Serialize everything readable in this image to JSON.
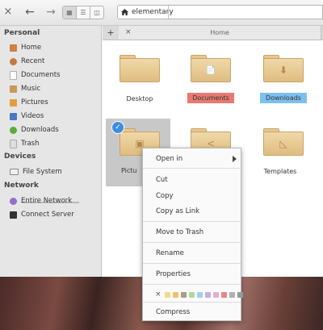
{
  "toolbar": {
    "close_icon": "×",
    "back_icon": "←",
    "forward_icon": "→",
    "view_modes": [
      "grid",
      "list",
      "columns"
    ],
    "path": "elementary"
  },
  "sidebar": {
    "sections": [
      {
        "title": "Personal",
        "items": [
          {
            "label": "Home",
            "icon": "home-icon",
            "color": "#d08040"
          },
          {
            "label": "Recent",
            "icon": "recent-icon",
            "color": "#c07a40"
          },
          {
            "label": "Documents",
            "icon": "documents-icon",
            "color": "#b0b0b0"
          },
          {
            "label": "Music",
            "icon": "music-icon",
            "color": "#c89858"
          },
          {
            "label": "Pictures",
            "icon": "pictures-icon",
            "color": "#e0a040"
          },
          {
            "label": "Videos",
            "icon": "videos-icon",
            "color": "#4a78c0"
          },
          {
            "label": "Downloads",
            "icon": "downloads-icon",
            "color": "#5caa3a"
          },
          {
            "label": "Trash",
            "icon": "trash-icon",
            "color": "#aaaaaa"
          }
        ]
      },
      {
        "title": "Devices",
        "items": [
          {
            "label": "File System",
            "icon": "drive-icon",
            "color": "#888888"
          }
        ]
      },
      {
        "title": "Network",
        "items": [
          {
            "label": "Entire Network",
            "icon": "network-icon",
            "color": "#9a6cc8"
          },
          {
            "label": "Connect Server",
            "icon": "server-icon",
            "color": "#333333"
          }
        ]
      }
    ]
  },
  "tabs": {
    "add_label": "+",
    "close_label": "×",
    "items": [
      {
        "label": "Home"
      }
    ]
  },
  "files": [
    {
      "name": "Desktop",
      "glyph": "",
      "tag_color": ""
    },
    {
      "name": "Documents",
      "glyph": "📄",
      "tag_color": "#e87a72"
    },
    {
      "name": "Downloads",
      "glyph": "⬇",
      "tag_color": "#7cc0f0"
    },
    {
      "name": "Pictu",
      "glyph": "▣",
      "tag_color": ""
    },
    {
      "name": "",
      "glyph": "<",
      "tag_color": ""
    },
    {
      "name": "Templates",
      "glyph": "◺",
      "tag_color": ""
    }
  ],
  "context_menu": {
    "items": [
      {
        "label": "Open in",
        "submenu": true
      },
      {
        "label": "Cut"
      },
      {
        "label": "Copy"
      },
      {
        "label": "Copy as Link"
      },
      {
        "label": "Move to Trash"
      },
      {
        "label": "Rename"
      },
      {
        "label": "Properties"
      },
      {
        "label": "Compress"
      }
    ],
    "clear_color_label": "×",
    "colors": [
      "#f5d98a",
      "#f0c070",
      "#a8a080",
      "#b0d8a0",
      "#a0d0f0",
      "#c0b0e0",
      "#e0b0d0",
      "#f08080",
      "#b0b0b0",
      "#909aa0"
    ]
  }
}
